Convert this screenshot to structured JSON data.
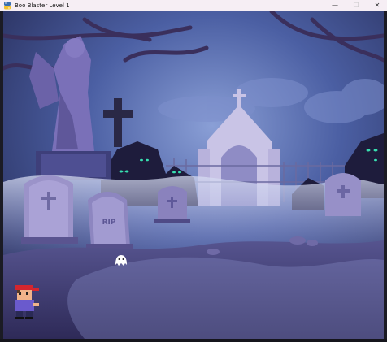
{
  "window": {
    "title": "Boo Blaster Level 1",
    "controls": {
      "minimize": "—",
      "maximize": "☐",
      "close": "✕"
    }
  },
  "scene": {
    "background": "haunted-graveyard",
    "tombstone_text": "RIP",
    "colors": {
      "sky": "#3b4d8a",
      "ground": "#3a3566",
      "fog": "#c9cde8",
      "ghost": "#ffffff",
      "player_cap": "#d4262e",
      "player_shirt": "#6a5acd",
      "glowing_eyes": "#38e0b0"
    }
  }
}
